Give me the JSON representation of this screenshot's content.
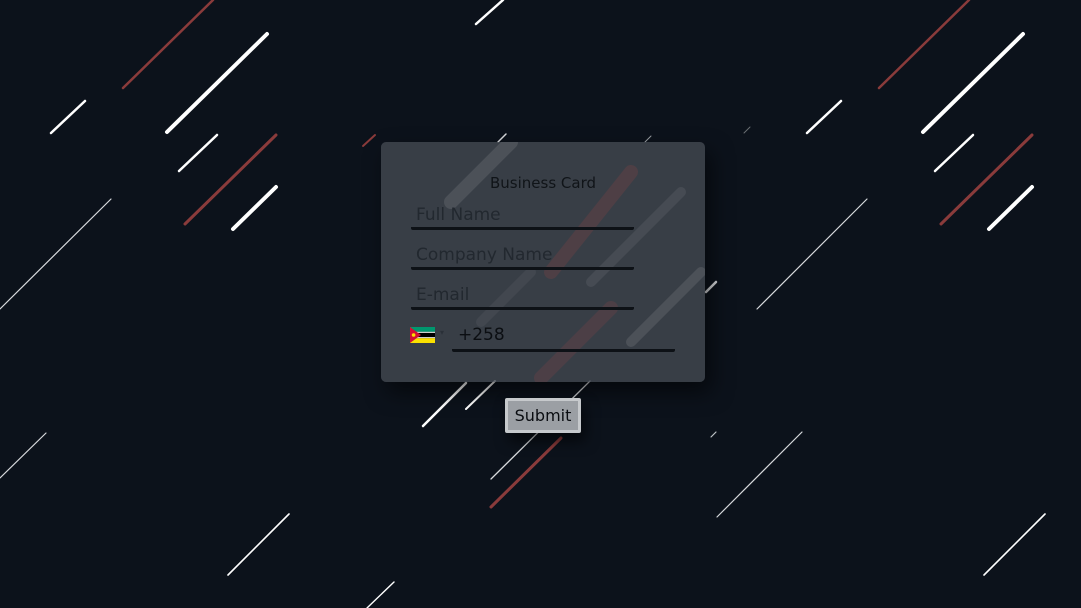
{
  "card": {
    "title": "Business Card"
  },
  "form": {
    "full_name_placeholder": "Full Name",
    "company_placeholder": "Company Name",
    "email_placeholder": "E-mail",
    "phone_value": "+258",
    "phone_flag_icon": "mozambique-flag-icon",
    "phone_dropdown_icon": "caret-down-icon",
    "phone_dropdown_glyph": "▾",
    "submit_label": "Submit"
  },
  "colors": {
    "background": "#0c121b",
    "card": "#424850",
    "line_white": "#ffffff",
    "line_red": "#8a3b3b",
    "button": "#9b9fa4"
  }
}
